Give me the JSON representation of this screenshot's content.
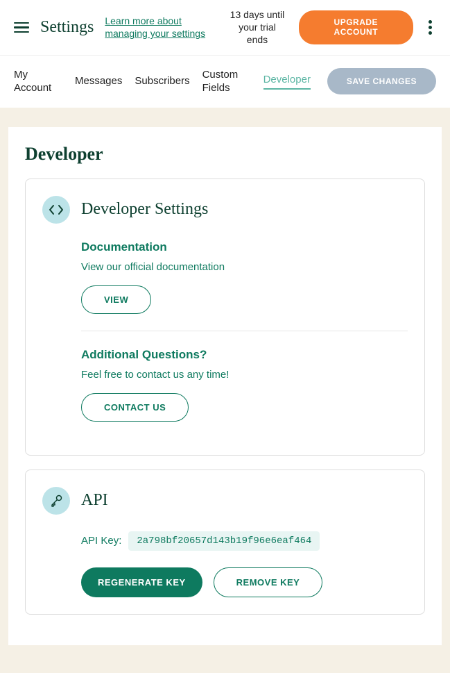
{
  "header": {
    "pageTitle": "Settings",
    "learnLink": "Learn more about managing your settings",
    "trialInfo": "13 days until\nyour trial ends",
    "upgradeLabel": "UPGRADE ACCOUNT"
  },
  "tabs": {
    "items": [
      "My Account",
      "Messages",
      "Subscribers",
      "Custom Fields",
      "Developer"
    ],
    "saveLabel": "SAVE CHANGES"
  },
  "section": {
    "title": "Developer"
  },
  "devSettings": {
    "title": "Developer Settings",
    "docTitle": "Documentation",
    "docText": "View our official documentation",
    "viewBtn": "VIEW",
    "questionsTitle": "Additional Questions?",
    "questionsText": "Feel free to contact us any time!",
    "contactBtn": "CONTACT US"
  },
  "api": {
    "title": "API",
    "keyLabel": "API Key:",
    "keyValue": "2a798bf20657d143b19f96e6eaf464",
    "regenBtn": "REGENERATE KEY",
    "removeBtn": "REMOVE KEY"
  }
}
